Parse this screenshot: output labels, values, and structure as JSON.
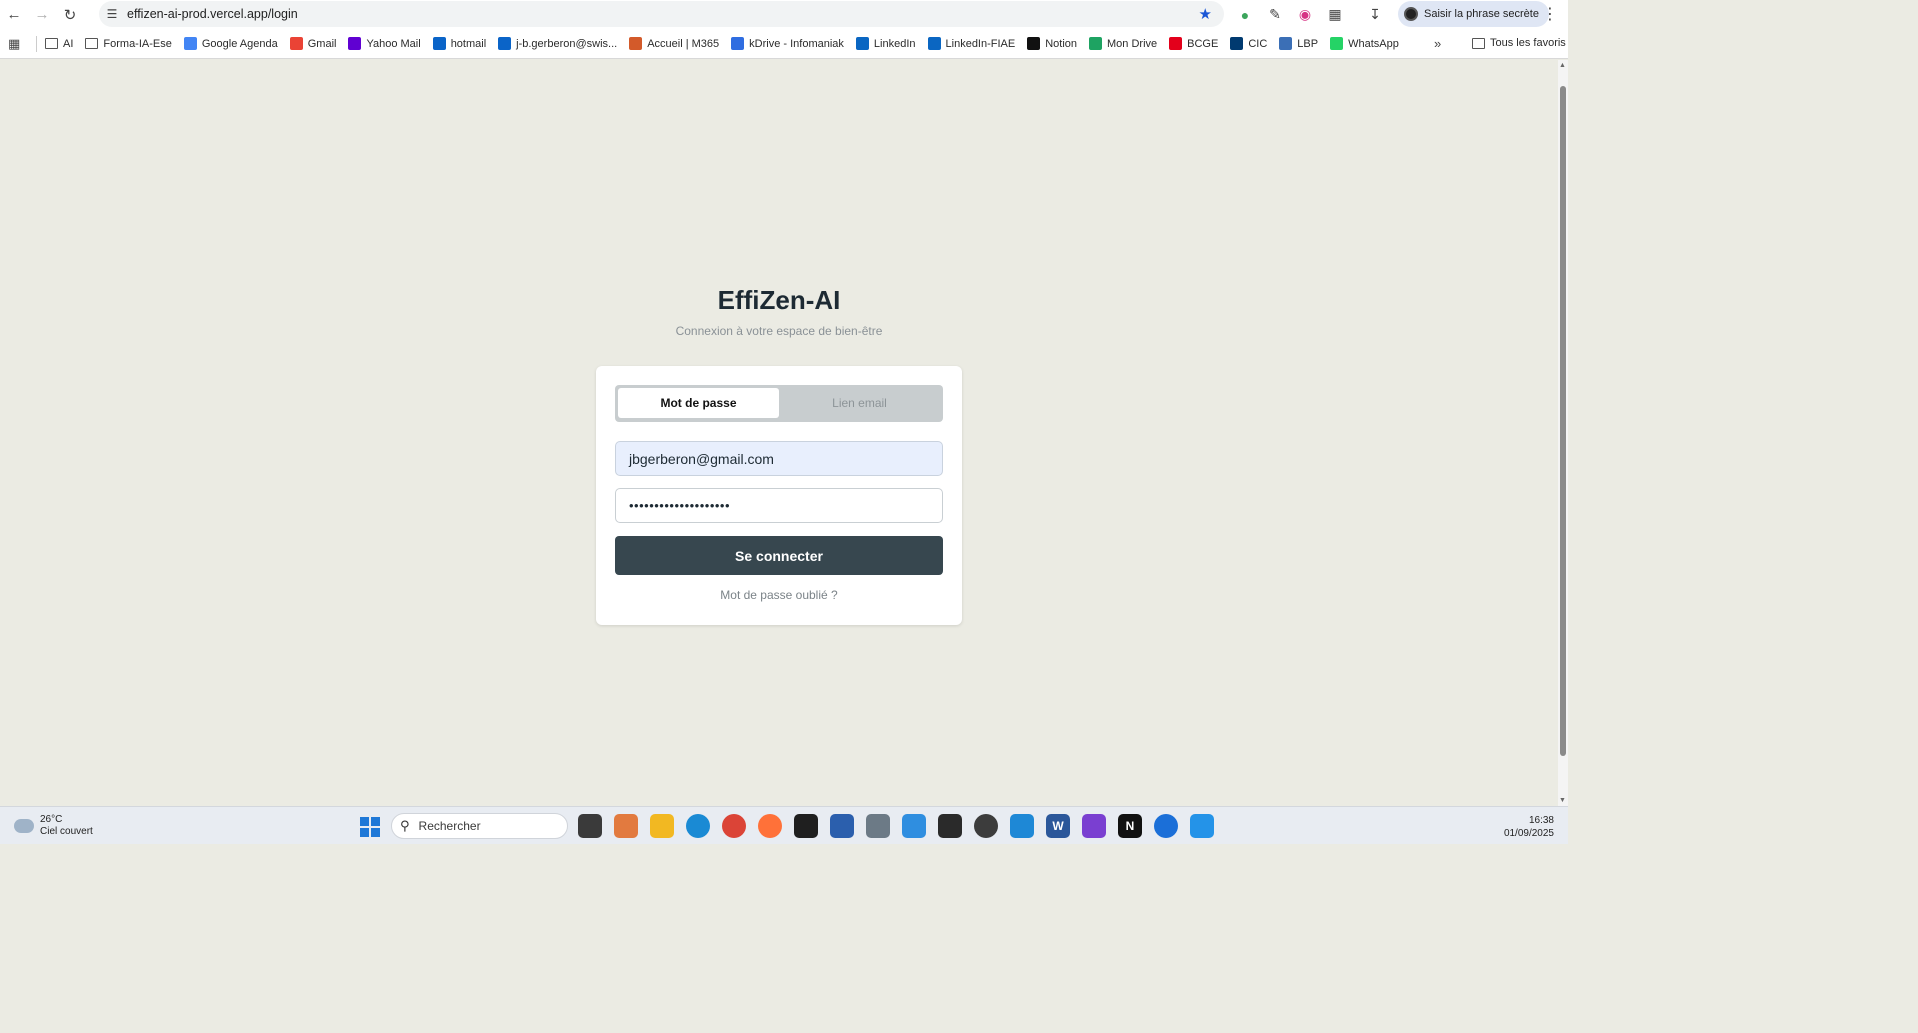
{
  "browser": {
    "url": "effizen-ai-prod.vercel.app/login",
    "profile_label": "Saisir la phrase secrète"
  },
  "bookmarks": {
    "items": [
      {
        "label": "AI",
        "icon": "folder-icon",
        "color": ""
      },
      {
        "label": "Forma-IA-Ese",
        "icon": "folder-icon",
        "color": ""
      },
      {
        "label": "Google Agenda",
        "icon": "calendar-icon",
        "color": "#4285f4"
      },
      {
        "label": "Gmail",
        "icon": "gmail-icon",
        "color": "#ea4335"
      },
      {
        "label": "Yahoo Mail",
        "icon": "yahoo-icon",
        "color": "#6001d2"
      },
      {
        "label": "hotmail",
        "icon": "outlook-icon",
        "color": "#0a64c8"
      },
      {
        "label": "j-b.gerberon@swis...",
        "icon": "outlook-icon",
        "color": "#0a64c8"
      },
      {
        "label": "Accueil | M365",
        "icon": "m365-icon",
        "color": "#d35a2a"
      },
      {
        "label": "kDrive - Infomaniak",
        "icon": "kdrive-icon",
        "color": "#2f6de1"
      },
      {
        "label": "LinkedIn",
        "icon": "linkedin-icon",
        "color": "#0a66c2"
      },
      {
        "label": "LinkedIn-FIAE",
        "icon": "linkedin-icon",
        "color": "#0a66c2"
      },
      {
        "label": "Notion",
        "icon": "notion-icon",
        "color": "#111111"
      },
      {
        "label": "Mon Drive",
        "icon": "drive-icon",
        "color": "#1ea362"
      },
      {
        "label": "BCGE",
        "icon": "bcge-icon",
        "color": "#e3001b"
      },
      {
        "label": "CIC",
        "icon": "cic-icon",
        "color": "#003a70"
      },
      {
        "label": "LBP",
        "icon": "lbp-icon",
        "color": "#3b6fb6"
      },
      {
        "label": "WhatsApp",
        "icon": "whatsapp-icon",
        "color": "#25d366"
      }
    ],
    "all_label": "Tous les favoris"
  },
  "login": {
    "brand": "EffiZen-AI",
    "tagline": "Connexion à votre espace de bien-être",
    "tab_password": "Mot de passe",
    "tab_email_link": "Lien email",
    "email_value": "jbgerberon@gmail.com",
    "password_mask": "••••••••••••••••••••",
    "submit_label": "Se connecter",
    "forgot_label": "Mot de passe oublié ?"
  },
  "taskbar": {
    "temperature": "26°C",
    "weather": "Ciel couvert",
    "search_placeholder": "Rechercher",
    "time": "16:38",
    "date": "01/09/2025"
  },
  "colors": {
    "page_bg": "#ebebe3",
    "button": "#37474f",
    "accent_star": "#1a56d6"
  }
}
